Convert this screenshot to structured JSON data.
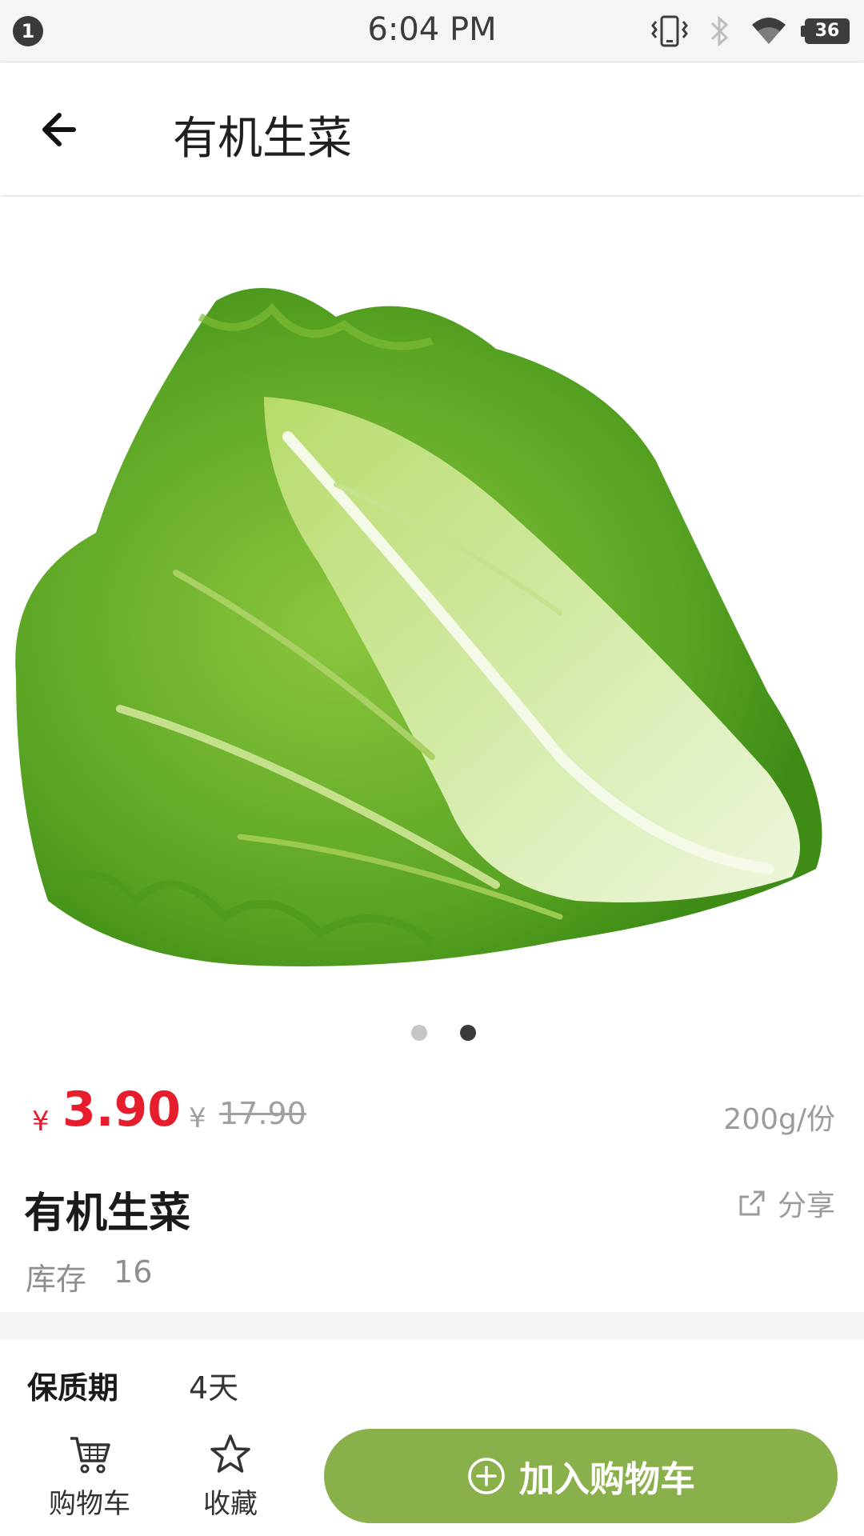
{
  "status_bar": {
    "notification_count": "1",
    "time": "6:04 PM",
    "battery": "36",
    "icons": [
      "vibrate-icon",
      "bluetooth-icon",
      "wifi-icon",
      "battery-icon"
    ]
  },
  "header": {
    "title": "有机生菜",
    "back_icon": "arrow-left-icon"
  },
  "gallery": {
    "image_subject": "lettuce",
    "total_pages": 2,
    "active_page": 2
  },
  "product": {
    "currency": "¥",
    "price": "3.90",
    "original_currency": "¥",
    "original_price": "17.90",
    "spec": "200g/份",
    "name": "有机生菜",
    "share_label": "分享",
    "stock_label": "库存",
    "stock_value": "16",
    "shelf_life_label": "保质期",
    "shelf_life_value": "4天"
  },
  "bottom_bar": {
    "cart_label": "购物车",
    "favorite_label": "收藏",
    "add_to_cart_label": "加入购物车"
  },
  "colors": {
    "price_red": "#e51d2c",
    "button_green": "#8ab04b",
    "muted_gray": "#9b9b9b"
  }
}
